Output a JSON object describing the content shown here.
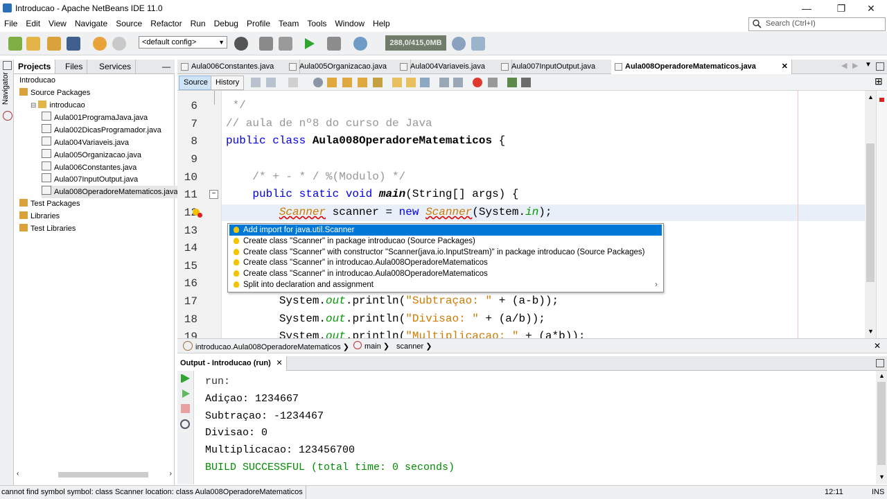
{
  "window": {
    "title": "Introducao - Apache NetBeans IDE 11.0",
    "min": "—",
    "restore": "❐",
    "close": "✕"
  },
  "menu": [
    "File",
    "Edit",
    "View",
    "Navigate",
    "Source",
    "Refactor",
    "Run",
    "Debug",
    "Profile",
    "Team",
    "Tools",
    "Window",
    "Help"
  ],
  "search": {
    "placeholder": "Search (Ctrl+I)"
  },
  "toolbar": {
    "config": "<default config>",
    "memory": "288,0/415,0MB"
  },
  "navigator": {
    "label": "Navigator"
  },
  "projects": {
    "tabs": [
      "Projects",
      "Files",
      "Services"
    ],
    "minimize": "—",
    "tree": [
      {
        "label": "Introducao",
        "level": 0
      },
      {
        "label": "Source Packages",
        "level": 1
      },
      {
        "label": "introducao",
        "level": 2
      },
      {
        "label": "Aula001ProgramaJava.java",
        "level": 3
      },
      {
        "label": "Aula002DicasProgramador.java",
        "level": 3
      },
      {
        "label": "Aula004Variaveis.java",
        "level": 3
      },
      {
        "label": "Aula005Organizacao.java",
        "level": 3
      },
      {
        "label": "Aula006Constantes.java",
        "level": 3
      },
      {
        "label": "Aula007InputOutput.java",
        "level": 3
      },
      {
        "label": "Aula008OperadoreMatematicos.java",
        "level": 3
      },
      {
        "label": "Test Packages",
        "level": 1
      },
      {
        "label": "Libraries",
        "level": 1
      },
      {
        "label": "Test Libraries",
        "level": 1
      }
    ]
  },
  "editor": {
    "tabs": [
      {
        "label": "Aula006Constantes.java",
        "active": false
      },
      {
        "label": "Aula005Organizacao.java",
        "active": false
      },
      {
        "label": "Aula004Variaveis.java",
        "active": false
      },
      {
        "label": "Aula007InputOutput.java",
        "active": false
      },
      {
        "label": "Aula008OperadoreMatematicos.java",
        "active": true
      }
    ],
    "source_tab": "Source",
    "history_tab": "History",
    "line_numbers": [
      "6",
      "7",
      "8",
      "9",
      "10",
      "11",
      "12",
      "13",
      "14",
      "15",
      "16",
      "17",
      "18",
      "19"
    ],
    "code": {
      "l6": " */",
      "l7": "// aula de nº8 do curso de Java",
      "l8_kw": "public class ",
      "l8_name": "Aula008OperadoreMatematicos",
      "l8_rest": " {",
      "l10": "    /* + - * / %(Modulo) */",
      "l11_kw": "    public static void ",
      "l11_main": "main",
      "l11_rest": "(String[] args) {",
      "l12_type": "Scanner",
      "l12_mid": " scanner = ",
      "l12_new": "new ",
      "l12_ctor": "Scanner",
      "l12_p1": "(System.",
      "l12_in": "in",
      "l12_p2": ");",
      "l17_a": "System.",
      "l17_out": "out",
      "l17_b": ".println(",
      "l17_str": "\"Subtraçao: \"",
      "l17_c": " + (a-b));",
      "l18_a": "System.",
      "l18_out": "out",
      "l18_b": ".println(",
      "l18_str": "\"Divisao: \"",
      "l18_c": " + (a/b));",
      "l19_a": "System.",
      "l19_out": "out",
      "l19_b": ".println(",
      "l19_str": "\"Multiplicacao: \"",
      "l19_c": " + (a*b));"
    }
  },
  "hints": [
    {
      "label": "Add import for java.util.Scanner",
      "selected": true
    },
    {
      "label": "Create class \"Scanner\" in package introducao (Source Packages)",
      "selected": false
    },
    {
      "label": "Create class \"Scanner\" with constructor \"Scanner(java.io.InputStream)\" in package introducao (Source Packages)",
      "selected": false
    },
    {
      "label": "Create class \"Scanner\" in introducao.Aula008OperadoreMatematicos",
      "selected": false
    },
    {
      "label": "Create class \"Scanner\" in introducao.Aula008OperadoreMatematicos",
      "selected": false
    },
    {
      "label": "Split into declaration and assignment",
      "selected": false
    }
  ],
  "breadcrumb": [
    "introducao.Aula008OperadoreMatematicos",
    "main",
    "scanner"
  ],
  "output": {
    "tab": "Output - Introducao (run)",
    "lines": [
      "run:",
      "Adiçao: 1234667",
      "Subtraçao: -1234467",
      "Divisao: 0",
      "Multiplicacao: 123456700",
      "BUILD SUCCESSFUL (total time: 0 seconds)"
    ]
  },
  "status": {
    "message": "cannot find symbol   symbol:  class Scanner   location: class Aula008OperadoreMatematicos",
    "position": "12:11",
    "mode": "INS"
  },
  "colors": {
    "keyword": "#0000e6",
    "comment": "#969696",
    "string": "#ce7b00",
    "selection": "#0078d7",
    "success": "#008c00"
  }
}
